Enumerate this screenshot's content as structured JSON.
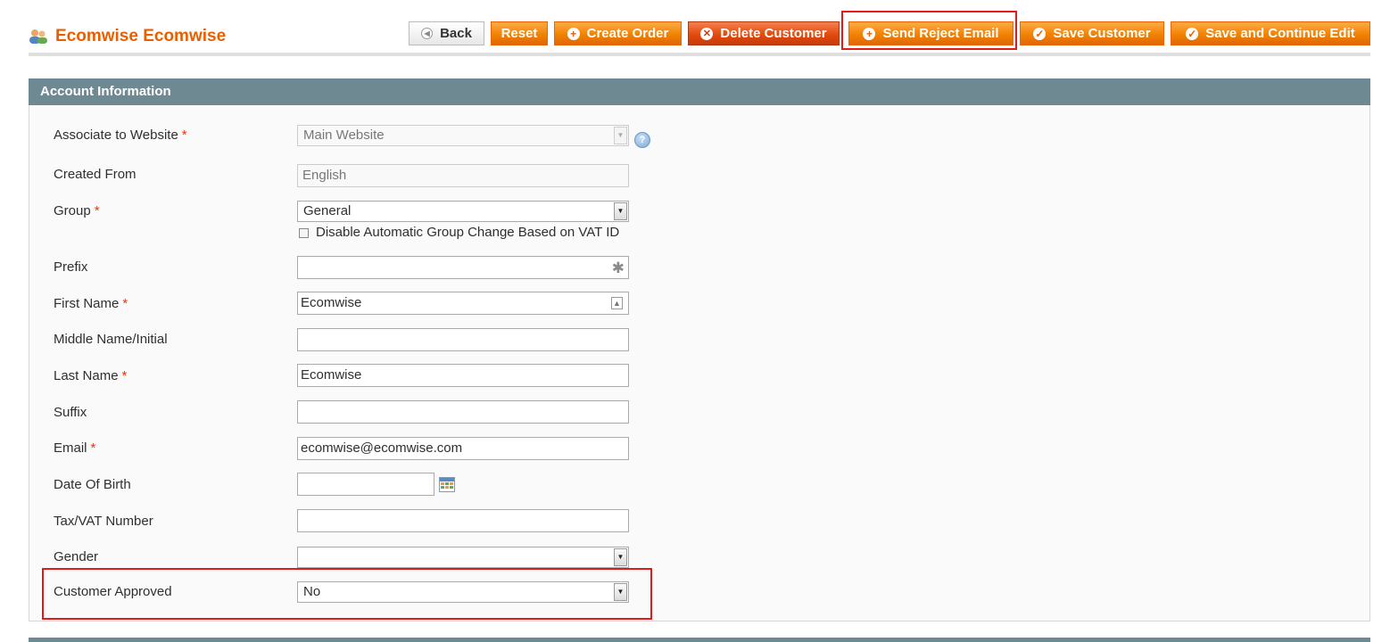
{
  "page": {
    "title": "Ecomwise Ecomwise",
    "title_icon": "customer-users-icon"
  },
  "toolbar": {
    "back": "Back",
    "reset": "Reset",
    "create_order": "Create Order",
    "delete_customer": "Delete Customer",
    "send_reject_email": "Send Reject Email",
    "save_customer": "Save Customer",
    "save_continue": "Save and Continue Edit"
  },
  "section": {
    "title": "Account Information"
  },
  "form": {
    "website": {
      "label": "Associate to Website",
      "value": "Main Website",
      "required": "*"
    },
    "created_from": {
      "label": "Created From",
      "value": "English"
    },
    "group": {
      "label": "Group",
      "value": "General",
      "required": "*",
      "checkbox_label": "Disable Automatic Group Change Based on VAT ID"
    },
    "prefix": {
      "label": "Prefix",
      "value": ""
    },
    "first_name": {
      "label": "First Name",
      "value": "Ecomwise",
      "required": "*"
    },
    "middle_name": {
      "label": "Middle Name/Initial",
      "value": ""
    },
    "last_name": {
      "label": "Last Name",
      "value": "Ecomwise",
      "required": "*"
    },
    "suffix": {
      "label": "Suffix",
      "value": ""
    },
    "email": {
      "label": "Email",
      "value": "ecomwise@ecomwise.com",
      "required": "*"
    },
    "dob": {
      "label": "Date Of Birth",
      "value": ""
    },
    "taxvat": {
      "label": "Tax/VAT Number",
      "value": ""
    },
    "gender": {
      "label": "Gender",
      "value": ""
    },
    "approved": {
      "label": "Customer Approved",
      "value": "No"
    }
  },
  "colors": {
    "brand_orange": "#eb5e00",
    "section_header": "#6f8992",
    "highlight_red": "#e01b1b"
  }
}
